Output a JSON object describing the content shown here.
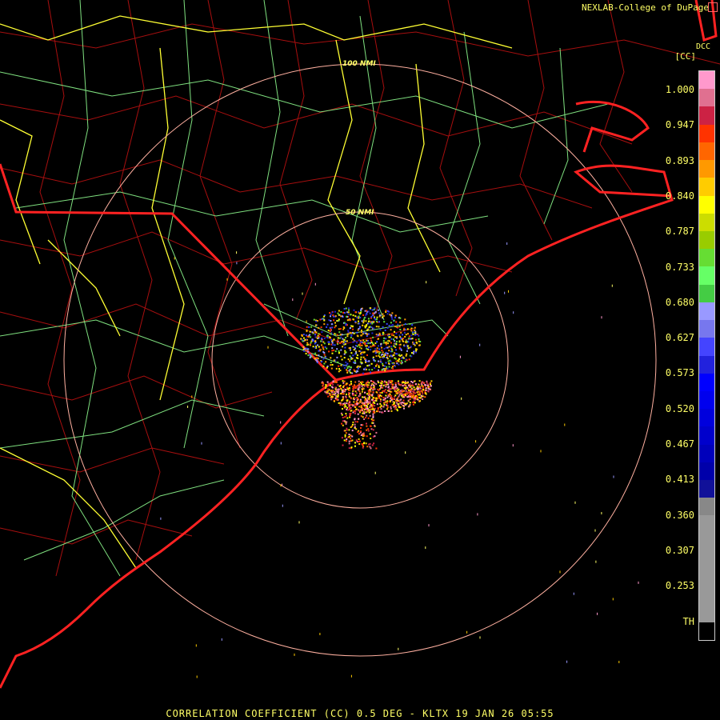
{
  "header": {
    "credit": "NEXLAB-College of DuPage",
    "site": "DCC",
    "product_code": "[CC]"
  },
  "rings": [
    {
      "label": "50 NMI"
    },
    {
      "label": "100 NMI"
    }
  ],
  "legend": {
    "ticks": [
      "1.000",
      "0.947",
      "0.893",
      "0.840",
      "0.787",
      "0.733",
      "0.680",
      "0.627",
      "0.573",
      "0.520",
      "0.467",
      "0.413",
      "0.360",
      "0.307",
      "0.253",
      "TH"
    ],
    "colors": [
      "#ff99cc",
      "#e07090",
      "#cc2244",
      "#ff3300",
      "#ff6600",
      "#ff9900",
      "#ffcc00",
      "#ffff00",
      "#ccdd00",
      "#99cc00",
      "#66dd33",
      "#66ff66",
      "#44cc44",
      "#9999ff",
      "#7777ee",
      "#4444ff",
      "#2222dd",
      "#0000ff",
      "#0000ee",
      "#0000dd",
      "#0000cc",
      "#0000bb",
      "#0000aa",
      "#111199",
      "#888888",
      "#999999",
      "#999999",
      "#999999",
      "#999999",
      "#999999",
      "#999999",
      "#000000"
    ]
  },
  "footer": "CORRELATION COEFFICIENT (CC) 0.5 DEG - KLTX 19 JAN 26 05:55",
  "colors": {
    "state_border": "#ff2222",
    "county": "#cc1111",
    "highway": "#88ff88",
    "interstate": "#ffff33",
    "ring": "#ffb0a0",
    "text": "#ffff66"
  }
}
